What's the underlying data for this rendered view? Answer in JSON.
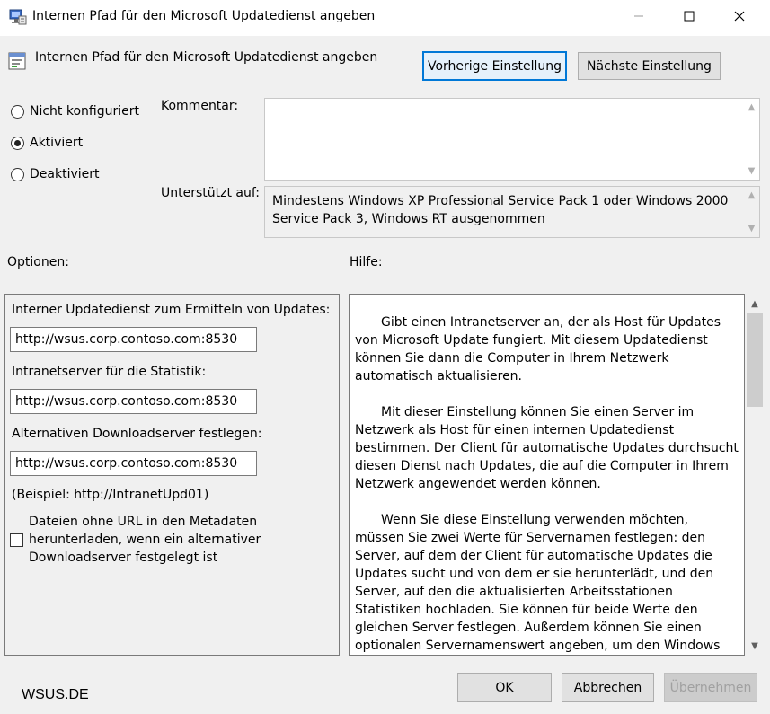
{
  "window": {
    "title": "Internen Pfad für den Microsoft Updatedienst angeben",
    "minimize_glyph": "—",
    "maximize_glyph": "☐",
    "close_glyph": "✕"
  },
  "header": {
    "title": "Internen Pfad für den Microsoft Updatedienst angeben",
    "prev_label": "Vorherige Einstellung",
    "next_label": "Nächste Einstellung"
  },
  "state": {
    "options": [
      {
        "label": "Nicht konfiguriert",
        "checked": false
      },
      {
        "label": "Aktiviert",
        "checked": true
      },
      {
        "label": "Deaktiviert",
        "checked": false
      }
    ]
  },
  "comment": {
    "label": "Kommentar:",
    "value": ""
  },
  "supported": {
    "label": "Unterstützt auf:",
    "text": "Mindestens Windows XP Professional Service Pack 1 oder Windows 2000 Service Pack 3, Windows RT ausgenommen"
  },
  "sections": {
    "options_label": "Optionen:",
    "help_label": "Hilfe:"
  },
  "options_panel": {
    "update_service_label": "Interner Updatedienst zum Ermitteln von Updates:",
    "update_service_value": "http://wsus.corp.contoso.com:8530",
    "statistics_label": "Intranetserver für die Statistik:",
    "statistics_value": "http://wsus.corp.contoso.com:8530",
    "alt_download_label": "Alternativen Downloadserver festlegen:",
    "alt_download_value": "http://wsus.corp.contoso.com:8530",
    "example": "(Beispiel: http://IntranetUpd01)",
    "checkbox_label": "Dateien ohne URL in den Metadaten herunterladen, wenn ein alternativer Downloadserver festgelegt ist",
    "checkbox_checked": false
  },
  "help": {
    "paragraphs": [
      "Gibt einen Intranetserver an, der als Host für Updates von Microsoft Update fungiert. Mit diesem Updatedienst können Sie dann die Computer in Ihrem Netzwerk automatisch aktualisieren.",
      "Mit dieser Einstellung können Sie einen Server im Netzwerk als Host für einen internen Updatedienst bestimmen. Der Client für automatische Updates durchsucht diesen Dienst nach Updates, die auf die Computer in Ihrem Netzwerk angewendet werden können.",
      "Wenn Sie diese Einstellung verwenden möchten, müssen Sie zwei Werte für Servernamen festlegen: den Server, auf dem der Client für automatische Updates die Updates sucht und von dem er sie herunterlädt, und den Server, auf den die aktualisierten Arbeitsstationen Statistiken hochladen. Sie können für beide Werte den gleichen Server festlegen. Außerdem können Sie einen optionalen Servernamenswert angeben, um den Windows Update-Agent so zu konfigurieren, dass er Updates von einem alternativen Downloadserver anstatt vom Updatedienst im Intranet herunterlädt."
    ]
  },
  "footer": {
    "ok_label": "OK",
    "cancel_label": "Abbrechen",
    "apply_label": "Übernehmen",
    "watermark": "WSUS.DE"
  },
  "colors": {
    "focus_border": "#0078d7",
    "dialog_background": "#f0f0f0"
  }
}
